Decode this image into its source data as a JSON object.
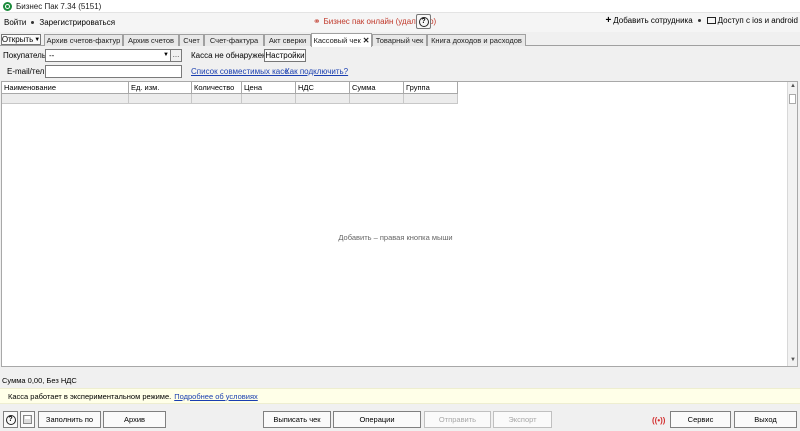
{
  "window": {
    "title": "Бизнес Пак 7.34 (5151)"
  },
  "menu": {
    "login": "Войти",
    "register": "Зарегистрироваться",
    "online_status": "Бизнес пак онлайн (удалённо)",
    "add_employee": "Добавить сотрудника",
    "access_mobile": "Доступ с ios и android"
  },
  "tabs": {
    "open_label": "Открыть",
    "items": [
      {
        "label": "Архив счетов-фактур"
      },
      {
        "label": "Архив счетов"
      },
      {
        "label": "Счет"
      },
      {
        "label": "Счет-фактура"
      },
      {
        "label": "Акт сверки"
      },
      {
        "label": "Кассовый чек",
        "active": true
      },
      {
        "label": "Товарный чек"
      },
      {
        "label": "Книга доходов и расходов"
      }
    ]
  },
  "form": {
    "buyer_label": "Покупатель",
    "buyer_value": "--",
    "kassa_status": "Касса не обнаружена",
    "settings_button": "Настройки",
    "email_label": "E-mail/тел.",
    "email_value": "",
    "compatible_link": "Список совместимых касс",
    "connect_link": "Как подключить?"
  },
  "table": {
    "columns": [
      "Наименование",
      "Ед. изм.",
      "Количество",
      "Цена",
      "НДС",
      "Сумма",
      "Группа"
    ],
    "empty_hint": "Добавить – правая кнопка мыши"
  },
  "summary": {
    "text": "Сумма 0,00, Без НДС"
  },
  "banner": {
    "text": "Касса работает в экспериментальном режиме.",
    "link": "Подробнее об условиях"
  },
  "bottom": {
    "fill_by": "Заполнить по",
    "archive": "Архив",
    "issue_receipt": "Выписать чек",
    "operations": "Операции",
    "send": "Отправить",
    "export": "Экспорт",
    "signal": "((•))",
    "service": "Сервис",
    "exit": "Выход"
  }
}
